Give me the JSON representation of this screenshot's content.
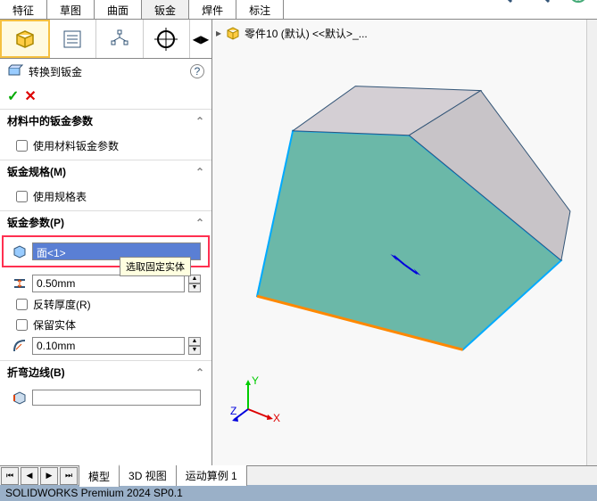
{
  "ribbon": {
    "tabs": [
      "特征",
      "草图",
      "曲面",
      "钣金",
      "焊件",
      "标注"
    ],
    "active_index": 3
  },
  "panel_tabs": {
    "items": [
      "feature-mgr",
      "property-mgr",
      "config-mgr",
      "dimxpert"
    ],
    "active_index": 0
  },
  "feature": {
    "title": "转换到钣金",
    "ok": "✓",
    "cancel": "✕",
    "help": "?"
  },
  "sections": {
    "material": {
      "title": "材料中的钣金参数",
      "use_material": "使用材料钣金参数"
    },
    "gauge": {
      "title": "钣金规格(M)",
      "use_table": "使用规格表"
    },
    "params": {
      "title": "钣金参数(P)",
      "fixed_face": "面<1>",
      "tooltip": "选取固定实体",
      "thickness": "0.50mm",
      "reverse": "反转厚度(R)",
      "keep": "保留实体",
      "bend_radius": "0.10mm"
    },
    "bend_edges": {
      "title": "折弯边线(B)"
    }
  },
  "viewport": {
    "breadcrumb_arrow": "▸",
    "part_name": "零件10 (默认) <<默认>_...",
    "triad": {
      "x": "X",
      "y": "Y",
      "z": "Z"
    }
  },
  "bottom_tabs": {
    "nav": [
      "⏮",
      "◀",
      "▶",
      "⏭"
    ],
    "tabs": [
      "模型",
      "3D 视图",
      "运动算例 1"
    ],
    "active_index": 0
  },
  "status": "SOLIDWORKS Premium 2024 SP0.1",
  "icons": {
    "search": "search",
    "zoom": "zoom",
    "view": "view"
  }
}
